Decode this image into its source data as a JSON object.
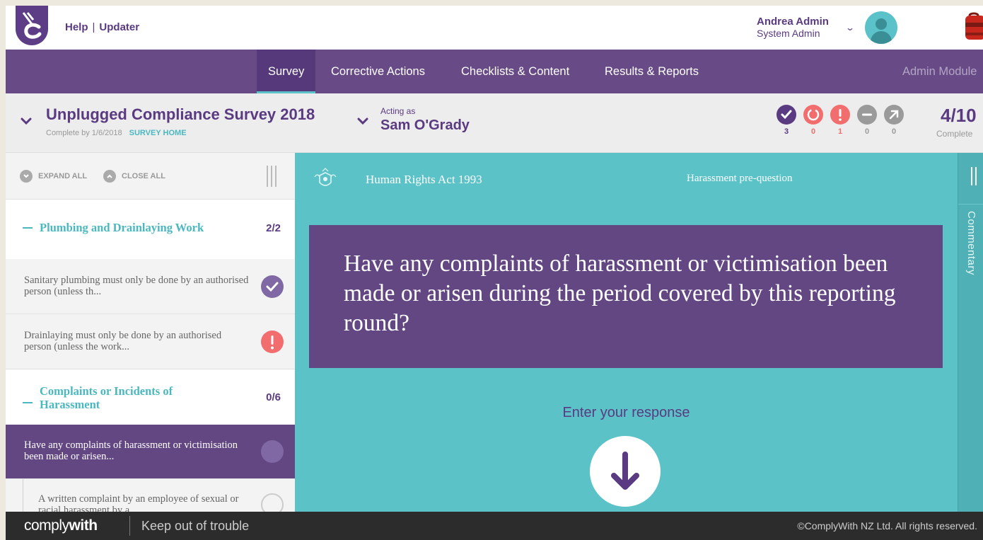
{
  "header": {
    "help_label": "Help",
    "updater_label": "Updater",
    "separator": "|",
    "user_name": "Andrea Admin",
    "user_role": "System Admin"
  },
  "nav": {
    "items": [
      "Survey",
      "Corrective Actions",
      "Checklists & Content",
      "Results & Reports"
    ],
    "active": "Survey",
    "admin_label": "Admin Module"
  },
  "survey": {
    "title": "Unplugged Compliance Survey 2018",
    "complete_by": "Complete by 1/6/2018",
    "home_link": "SURVEY HOME",
    "acting_label": "Acting as",
    "acting_name": "Sam O'Grady",
    "stats": [
      {
        "icon": "check-icon",
        "count": "3",
        "color": "#5a3a80"
      },
      {
        "icon": "in-progress-icon",
        "count": "0",
        "color": "#f26d6d"
      },
      {
        "icon": "alert-icon",
        "count": "1",
        "color": "#f26d6d"
      },
      {
        "icon": "not-applicable-icon",
        "count": "0",
        "color": "#9a9a9a"
      },
      {
        "icon": "delegated-icon",
        "count": "0",
        "color": "#9a9a9a"
      }
    ],
    "progress": "4/10",
    "progress_label": "Complete"
  },
  "sidebar": {
    "expand_all": "EXPAND ALL",
    "close_all": "CLOSE ALL",
    "sections": [
      {
        "title": "Plumbing and Drainlaying Work",
        "count": "2/2",
        "questions": [
          {
            "text": "Sanitary plumbing must only be done by an authorised person (unless th...",
            "status": "complete"
          },
          {
            "text": "Drainlaying must only be done by an authorised person (unless the work...",
            "status": "alert"
          }
        ]
      },
      {
        "title": "Complaints or Incidents of Harassment",
        "count": "0/6",
        "questions": [
          {
            "text": "Have any complaints of harassment or victimisation been made or arisen...",
            "status": "active"
          },
          {
            "text": "A written complaint by an employee of sexual or racial harassment by a...",
            "status": "empty"
          }
        ]
      }
    ]
  },
  "main": {
    "act_name": "Human Rights Act 1993",
    "question_label": "Harassment pre-question",
    "question": "Have any complaints of harassment or victimisation been made or arisen during the period covered by this reporting round?",
    "response_prompt": "Enter your response"
  },
  "commentary": {
    "label": "Commentary"
  },
  "footer": {
    "brand_light": "comply",
    "brand_bold": "with",
    "tagline": "Keep out of trouble",
    "copyright": "©ComplyWith NZ Ltd. All rights reserved."
  },
  "colors": {
    "purple": "#674a86",
    "teal": "#5bc3c8",
    "alert": "#f26d6d"
  }
}
